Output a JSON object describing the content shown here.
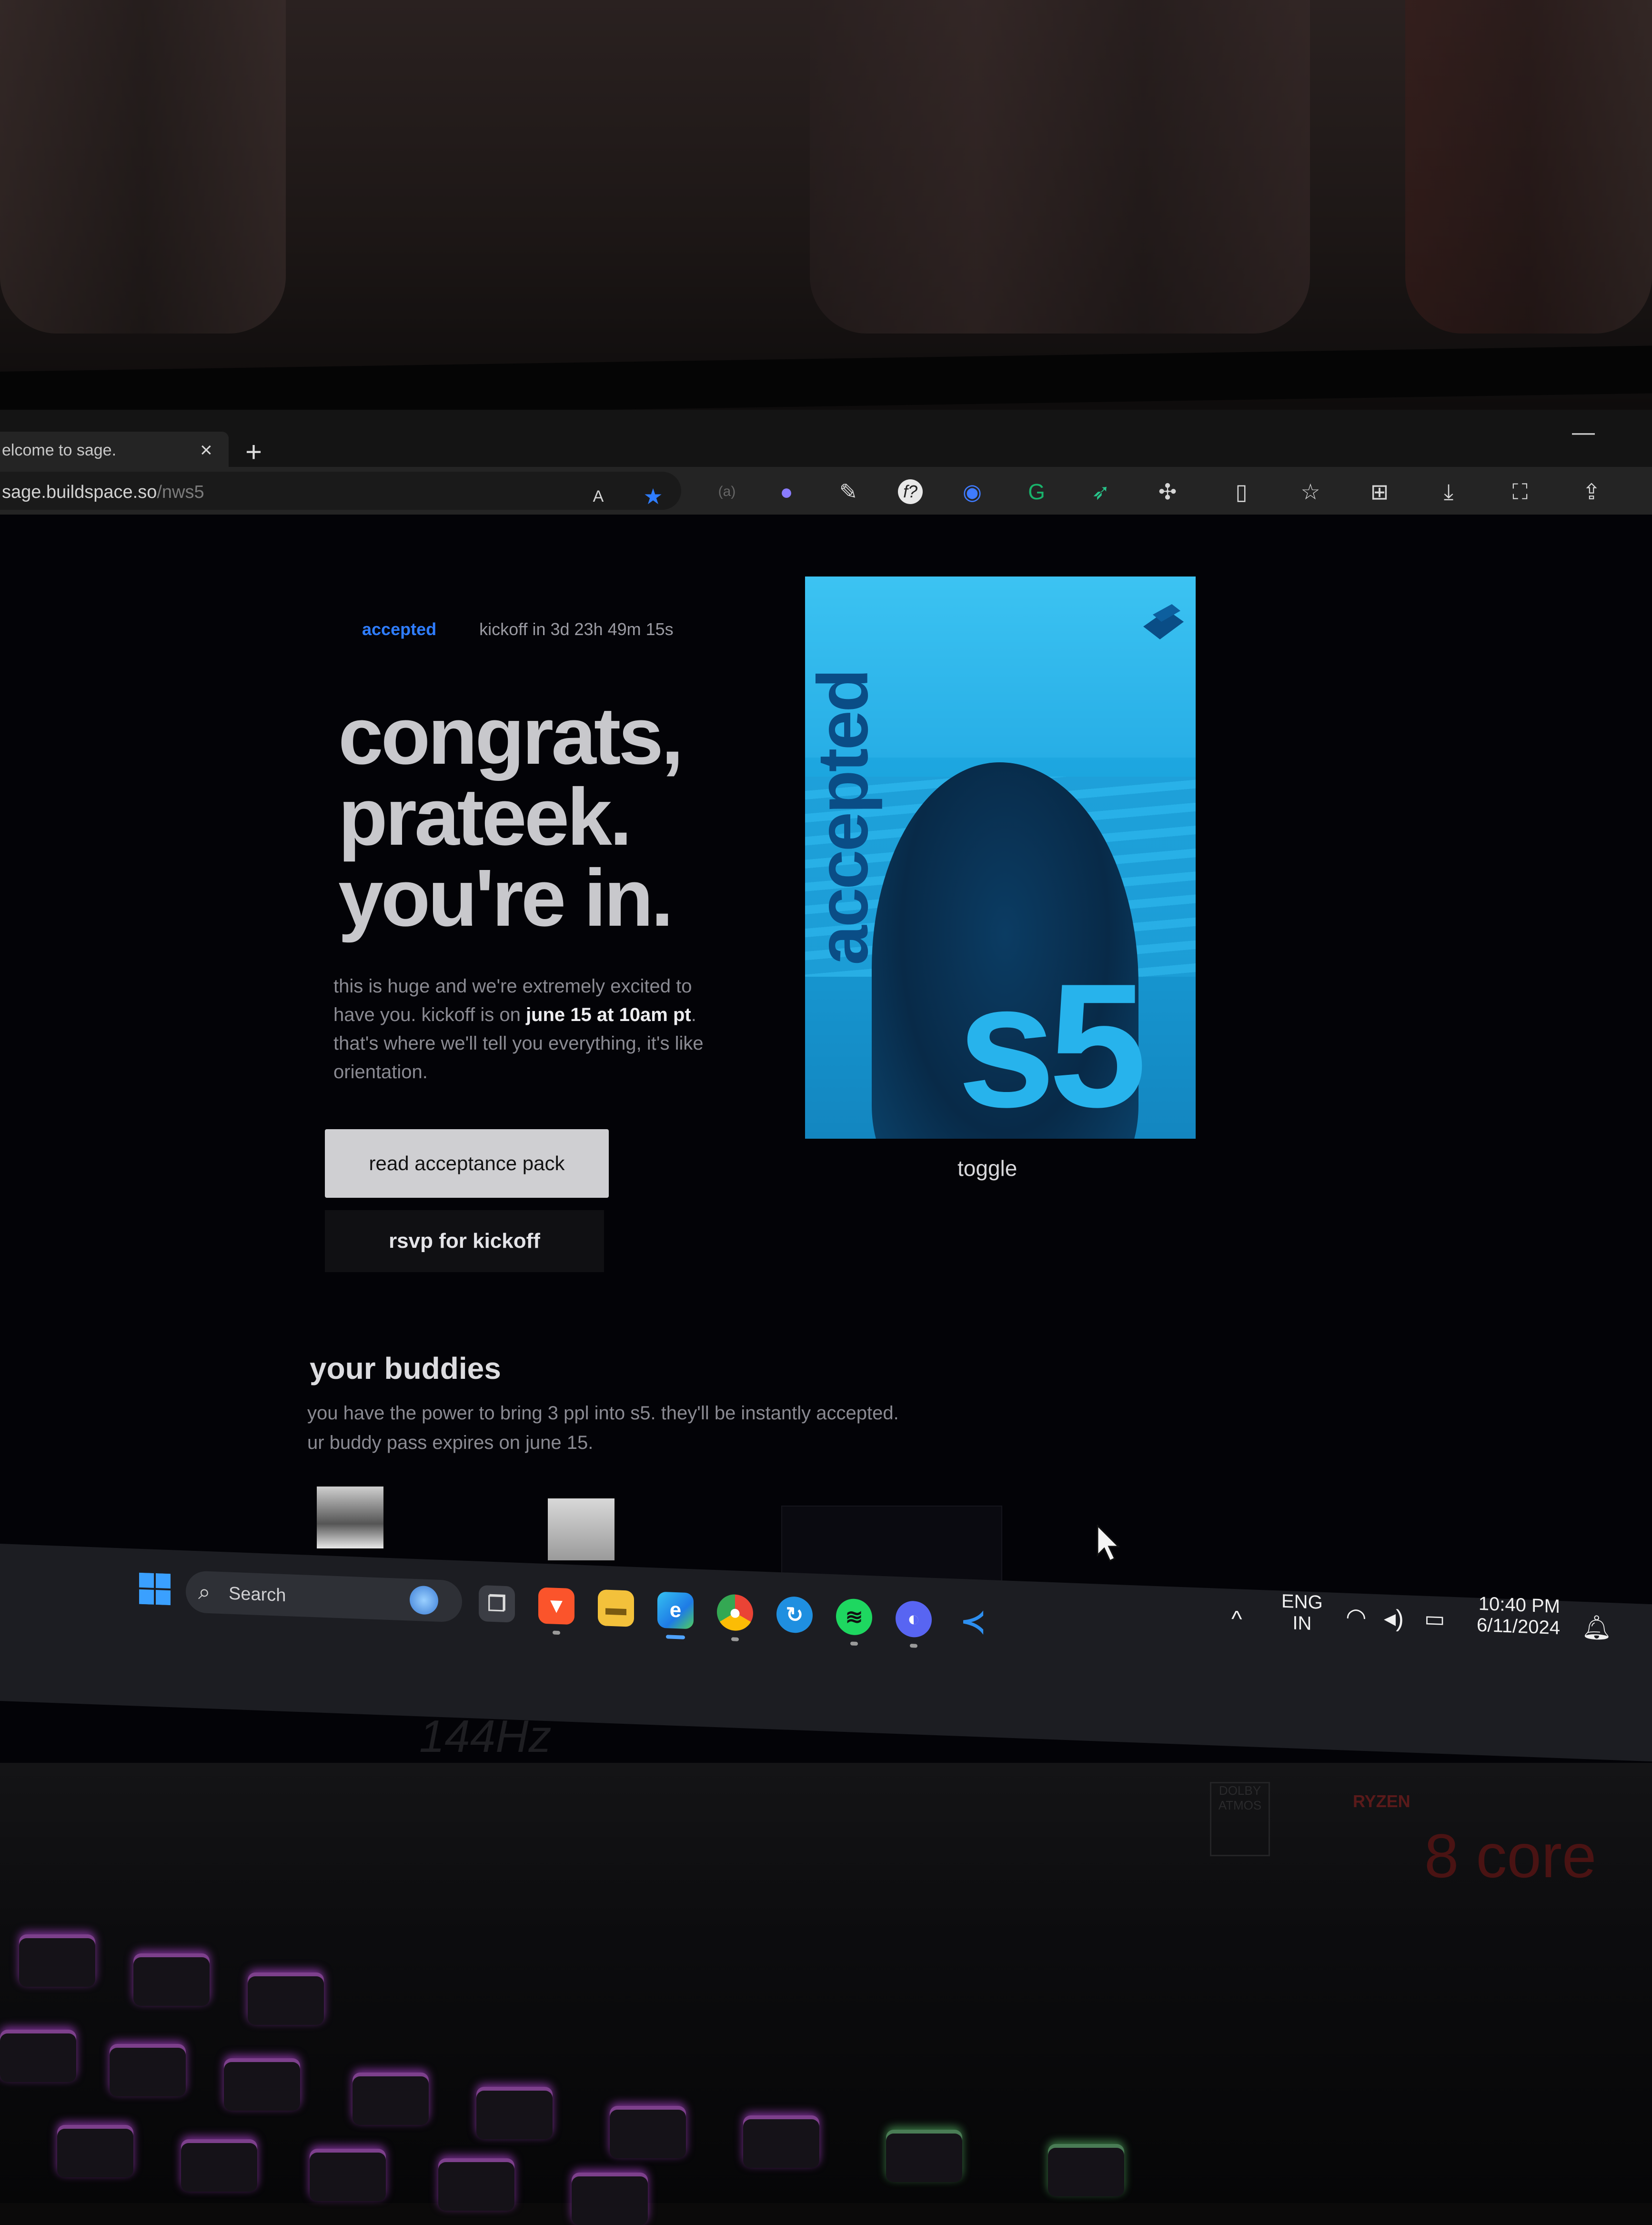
{
  "browser": {
    "tab_title": "elcome to sage.",
    "tab_close": "×",
    "new_tab": "+",
    "minimize": "—",
    "url_host": "sage.buildspace.so",
    "url_path": "/nws5",
    "toolbar_icons": [
      "read-aloud-icon",
      "favorite-star-icon",
      "extension-icon",
      "arc-icon",
      "eyedropper-icon",
      "formula-icon",
      "bitwarden-icon",
      "grammarly-icon",
      "bird-extension-icon",
      "extensions-puzzle-icon",
      "split-screen-icon",
      "favorites-icon",
      "collections-icon",
      "download-icon",
      "screenshot-icon",
      "share-icon"
    ],
    "star_color": "#2f7dff"
  },
  "page": {
    "status": "accepted",
    "kickoff_countdown": "kickoff in 3d 23h 49m 15s",
    "headline": [
      "congrats,",
      "prateek.",
      "you're in."
    ],
    "body_part1": "this is huge and we're extremely excited to have you. kickoff is on ",
    "body_bold": "june 15 at 10am pt",
    "body_part2": ". that's where we'll tell you everything, it's like orientation.",
    "primary_button": "read acceptance pack",
    "secondary_button": "rsvp for kickoff",
    "poster_vertical_text": "accepted",
    "poster_big_text": "s5",
    "toggle_label": "toggle",
    "buddies_title": "your buddies",
    "buddies_desc_line1": "you have the power to bring 3 ppl into s5. they'll be instantly accepted.",
    "buddies_desc_line2": "ur buddy pass expires on june 15.",
    "accent_color": "#2f7dff",
    "poster_color": "#29b3ea"
  },
  "taskbar": {
    "search_placeholder": "Search",
    "apps": [
      "task-view",
      "brave",
      "file-explorer",
      "edge",
      "chrome",
      "sync-app",
      "spotify",
      "discord",
      "vscode"
    ],
    "lang_line1": "ENG",
    "lang_line2": "IN",
    "time": "10:40 PM",
    "date": "6/11/2024",
    "chevron": "^"
  },
  "hardware": {
    "refresh_label": "144Hz",
    "cpu_brand": "RYZEN",
    "cpu_cores": "8 core",
    "audio_brand": "DOLBY ATMOS"
  }
}
